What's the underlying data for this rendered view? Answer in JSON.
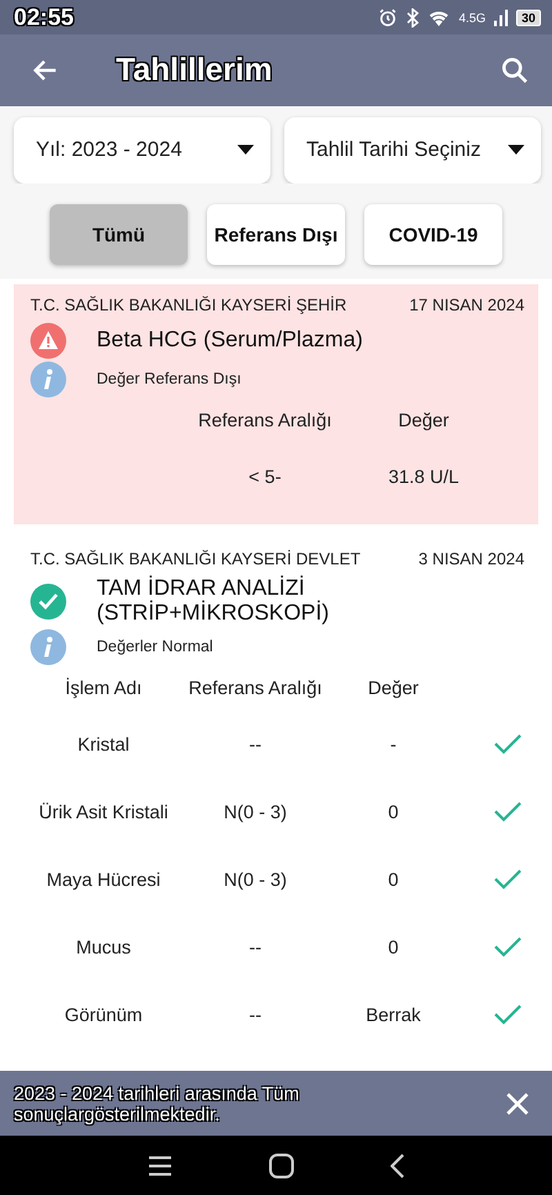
{
  "status_bar": {
    "time": "02:55",
    "network": "4.5G",
    "battery": "30"
  },
  "app_bar": {
    "title": "Tahlillerim"
  },
  "filters": [
    {
      "label": "Yıl: 2023 - 2024"
    },
    {
      "label": "Tahlil Tarihi Seçiniz"
    }
  ],
  "tabs": [
    {
      "label": "Tümü",
      "selected": true
    },
    {
      "label": "Referans Dışı",
      "selected": false
    },
    {
      "label": "COVID-19",
      "selected": false
    }
  ],
  "results": [
    {
      "kind": "abnormal",
      "hospital": "T.C. SAĞLIK BAKANLIĞI KAYSERİ ŞEHİR",
      "date": "17 NISAN 2024",
      "test": "Beta HCG (Serum/Plazma)",
      "note": "Değer Referans Dışı",
      "columns": [
        "Referans Aralığı",
        "Değer"
      ],
      "rows": [
        {
          "cells": [
            "< 5-",
            "31.8 U/L"
          ]
        }
      ]
    },
    {
      "kind": "normal",
      "hospital": "T.C. SAĞLIK BAKANLIĞI KAYSERİ DEVLET",
      "date": "3 NISAN 2024",
      "test": "TAM İDRAR ANALİZİ (STRİP+MİKROSKOPİ)",
      "note": "Değerler Normal",
      "columns": [
        "İşlem Adı",
        "Referans Aralığı",
        "Değer"
      ],
      "rows": [
        {
          "cells": [
            "Kristal",
            "--",
            "-"
          ],
          "ok": true
        },
        {
          "cells": [
            "Ürik Asit Kristali",
            "N(0 - 3)",
            "0"
          ],
          "ok": true
        },
        {
          "cells": [
            "Maya Hücresi",
            "N(0 - 3)",
            "0"
          ],
          "ok": true
        },
        {
          "cells": [
            "Mucus",
            "--",
            "0"
          ],
          "ok": true
        },
        {
          "cells": [
            "Görünüm",
            "--",
            "Berrak"
          ],
          "ok": true
        }
      ]
    }
  ],
  "toast": {
    "message": "2023 - 2024 tarihleri arasında Tüm sonuçlargösterilmektedir."
  }
}
